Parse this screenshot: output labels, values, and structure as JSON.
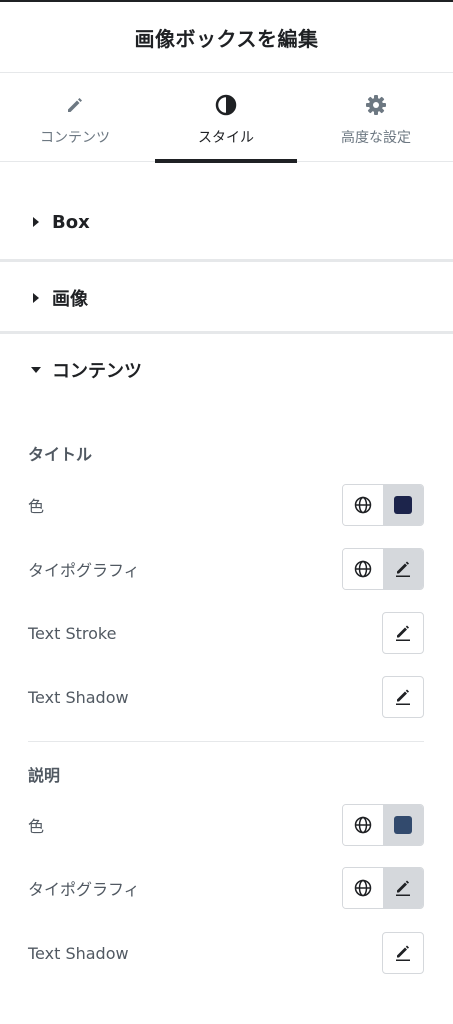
{
  "header": {
    "title": "画像ボックスを編集"
  },
  "tabs": [
    {
      "label": "コンテンツ",
      "icon": "pencil-icon"
    },
    {
      "label": "スタイル",
      "icon": "contrast-icon",
      "active": true
    },
    {
      "label": "高度な設定",
      "icon": "gear-icon"
    }
  ],
  "sections": {
    "box": {
      "title": "Box",
      "expanded": false
    },
    "image": {
      "title": "画像",
      "expanded": false
    },
    "content": {
      "title": "コンテンツ",
      "expanded": true
    }
  },
  "title_group": {
    "heading": "タイトル",
    "color_label": "色",
    "color_value": "#1c244b",
    "typography_label": "タイポグラフィ",
    "text_stroke_label": "Text Stroke",
    "text_shadow_label": "Text Shadow"
  },
  "description_group": {
    "heading": "説明",
    "color_label": "色",
    "color_value": "#324a6d",
    "typography_label": "タイポグラフィ",
    "text_shadow_label": "Text Shadow"
  },
  "colors": {
    "text_primary": "#1f2124",
    "text_secondary": "#515962",
    "border": "#d5d8dc",
    "separator": "#e6e8ea"
  }
}
